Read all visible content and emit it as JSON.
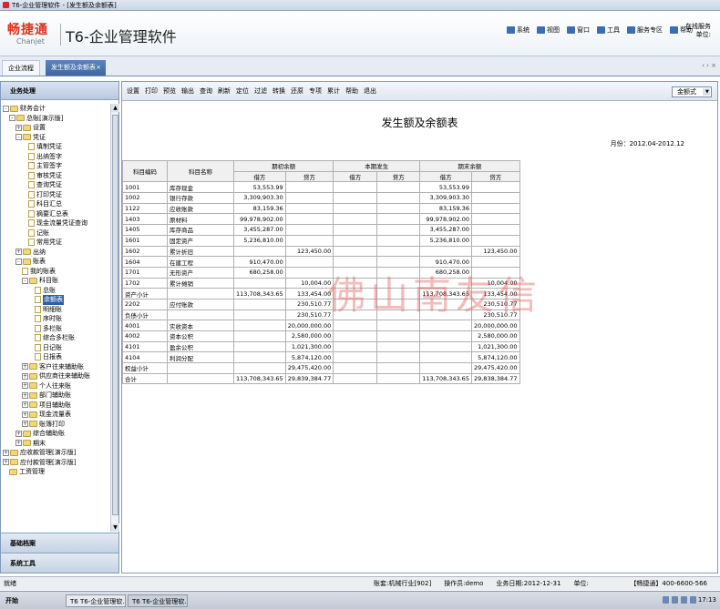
{
  "window": {
    "title": "T6-企业管理软件 - [发生额及余额表]"
  },
  "header": {
    "logo_cn": "畅捷通",
    "logo_en": "Chanjet",
    "product": "T6-企业管理软件",
    "nav": [
      "系统",
      "视图",
      "窗口",
      "工具",
      "服务专区",
      "帮助"
    ],
    "online_line1": "在线服务",
    "online_line2": "单位:"
  },
  "tabs": [
    {
      "label": "企业流程"
    },
    {
      "label": "发生额及余额表"
    }
  ],
  "tab_arrows": "‹ › ×",
  "sidebar": {
    "title": "业务处理",
    "footer1": "基础档案",
    "footer2": "系统工具",
    "tree": [
      {
        "l": "财务会计",
        "d": 0,
        "t": "pm",
        "s": "-"
      },
      {
        "l": "总账[演示版]",
        "d": 1,
        "t": "pm",
        "s": "-"
      },
      {
        "l": "设置",
        "d": 2,
        "t": "pm",
        "s": "+"
      },
      {
        "l": "凭证",
        "d": 2,
        "t": "pm",
        "s": "-"
      },
      {
        "l": "填制凭证",
        "d": 4,
        "t": "doc"
      },
      {
        "l": "出纳签字",
        "d": 4,
        "t": "doc"
      },
      {
        "l": "主管签字",
        "d": 4,
        "t": "doc"
      },
      {
        "l": "审核凭证",
        "d": 4,
        "t": "doc"
      },
      {
        "l": "查询凭证",
        "d": 4,
        "t": "doc"
      },
      {
        "l": "打印凭证",
        "d": 4,
        "t": "doc"
      },
      {
        "l": "科目汇总",
        "d": 4,
        "t": "doc"
      },
      {
        "l": "摘要汇总表",
        "d": 4,
        "t": "doc"
      },
      {
        "l": "现金流量凭证查询",
        "d": 4,
        "t": "doc"
      },
      {
        "l": "记账",
        "d": 4,
        "t": "doc"
      },
      {
        "l": "常用凭证",
        "d": 4,
        "t": "doc"
      },
      {
        "l": "出纳",
        "d": 2,
        "t": "pm",
        "s": "+"
      },
      {
        "l": "账表",
        "d": 2,
        "t": "pm",
        "s": "-"
      },
      {
        "l": "我的账表",
        "d": 3,
        "t": "doc"
      },
      {
        "l": "科目账",
        "d": 3,
        "t": "pm",
        "s": "-"
      },
      {
        "l": "总账",
        "d": 5,
        "t": "doc"
      },
      {
        "l": "余额表",
        "d": 5,
        "t": "doc",
        "sel": true
      },
      {
        "l": "明细账",
        "d": 5,
        "t": "doc"
      },
      {
        "l": "序时账",
        "d": 5,
        "t": "doc"
      },
      {
        "l": "多栏账",
        "d": 5,
        "t": "doc"
      },
      {
        "l": "综合多栏账",
        "d": 5,
        "t": "doc"
      },
      {
        "l": "日记账",
        "d": 5,
        "t": "doc"
      },
      {
        "l": "日报表",
        "d": 5,
        "t": "doc"
      },
      {
        "l": "客户往来辅助账",
        "d": 3,
        "t": "pm",
        "s": "+"
      },
      {
        "l": "供应商往来辅助账",
        "d": 3,
        "t": "pm",
        "s": "+"
      },
      {
        "l": "个人往来账",
        "d": 3,
        "t": "pm",
        "s": "+"
      },
      {
        "l": "部门辅助账",
        "d": 3,
        "t": "pm",
        "s": "+"
      },
      {
        "l": "项目辅助账",
        "d": 3,
        "t": "pm",
        "s": "+"
      },
      {
        "l": "现金流量表",
        "d": 3,
        "t": "pm",
        "s": "+"
      },
      {
        "l": "账簿打印",
        "d": 3,
        "t": "pm",
        "s": "+"
      },
      {
        "l": "综合辅助账",
        "d": 2,
        "t": "pm",
        "s": "+"
      },
      {
        "l": "期末",
        "d": 2,
        "t": "pm",
        "s": "+"
      },
      {
        "l": "应收款管理[演示版]",
        "d": 0,
        "t": "pm",
        "s": "+"
      },
      {
        "l": "应付款管理[演示版]",
        "d": 0,
        "t": "pm",
        "s": "+"
      },
      {
        "l": "工资管理",
        "d": 1,
        "t": "fold"
      }
    ]
  },
  "toolbar": {
    "items": [
      "设置",
      "打印",
      "预览",
      "输出",
      "查询",
      "刷新",
      "定位",
      "过滤",
      "转换",
      "还原",
      "专项",
      "累计",
      "帮助",
      "退出"
    ],
    "format": "金额式"
  },
  "report": {
    "title": "发生额及余额表",
    "period": "月份：2012.04-2012.12",
    "h_code": "科目编码",
    "h_name": "科目名称",
    "h_begin": "期初余额",
    "h_period": "本期发生",
    "h_end": "期末余额",
    "h_debit": "借方",
    "h_credit": "贷方",
    "rows": [
      [
        "1001",
        "库存现金",
        "53,553.99",
        "",
        "",
        "",
        "53,553.99",
        ""
      ],
      [
        "1002",
        "银行存款",
        "3,309,903.30",
        "",
        "",
        "",
        "3,309,903.30",
        ""
      ],
      [
        "1122",
        "应收账款",
        "83,159.36",
        "",
        "",
        "",
        "83,159.36",
        ""
      ],
      [
        "1403",
        "原材料",
        "99,978,902.00",
        "",
        "",
        "",
        "99,978,902.00",
        ""
      ],
      [
        "1405",
        "库存商品",
        "3,455,287.00",
        "",
        "",
        "",
        "3,455,287.00",
        ""
      ],
      [
        "1601",
        "固定资产",
        "5,236,810.00",
        "",
        "",
        "",
        "5,236,810.00",
        ""
      ],
      [
        "1602",
        "累计折旧",
        "",
        "123,450.00",
        "",
        "",
        "",
        "123,450.00"
      ],
      [
        "1604",
        "在建工程",
        "910,470.00",
        "",
        "",
        "",
        "910,470.00",
        ""
      ],
      [
        "1701",
        "无形资产",
        "680,258.00",
        "",
        "",
        "",
        "680,258.00",
        ""
      ],
      [
        "1702",
        "累计摊销",
        "",
        "10,004.00",
        "",
        "",
        "",
        "10,004.00"
      ],
      [
        "资产小计",
        "",
        "113,708,343.65",
        "133,454.00",
        "",
        "",
        "113,708,343.65",
        "133,454.00"
      ],
      [
        "2202",
        "应付账款",
        "",
        "230,510.77",
        "",
        "",
        "",
        "230,510.77"
      ],
      [
        "负债小计",
        "",
        "",
        "230,510.77",
        "",
        "",
        "",
        "230,510.77"
      ],
      [
        "4001",
        "实收资本",
        "",
        "20,000,000.00",
        "",
        "",
        "",
        "20,000,000.00"
      ],
      [
        "4002",
        "资本公积",
        "",
        "2,580,000.00",
        "",
        "",
        "",
        "2,580,000.00"
      ],
      [
        "4101",
        "盈余公积",
        "",
        "1,021,300.00",
        "",
        "",
        "",
        "1,021,300.00"
      ],
      [
        "4104",
        "利润分配",
        "",
        "5,874,120.00",
        "",
        "",
        "",
        "5,874,120.00"
      ],
      [
        "权益小计",
        "",
        "",
        "29,475,420.00",
        "",
        "",
        "",
        "29,475,420.00"
      ],
      [
        "合计",
        "",
        "113,708,343.65",
        "29,839,384.77",
        "",
        "",
        "113,708,343.65",
        "29,838,384.77"
      ]
    ],
    "watermark": "佛山南友信"
  },
  "status": {
    "left": "就绪",
    "account": "账套:机械行业[902]",
    "operator": "操作员:demo",
    "bizdate": "业务日期:2012-12-31",
    "unit": "单位:",
    "hotline": "【畅捷通】400-6600-566"
  },
  "taskbar": {
    "start": "开始",
    "task1": "T6 T6-企业管理软...",
    "task2": "T6 T6-企业管理软...",
    "time": "17:13"
  }
}
